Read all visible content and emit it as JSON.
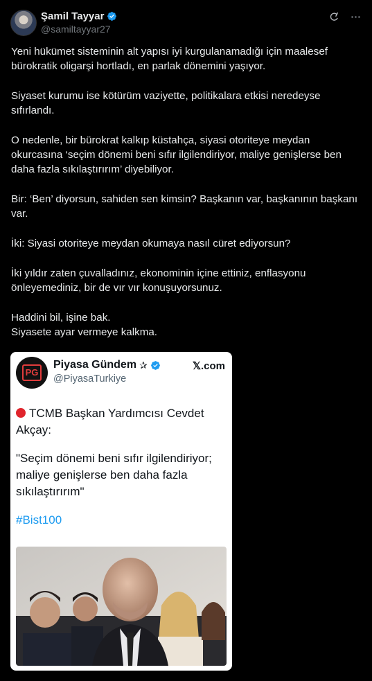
{
  "author": {
    "name": "Şamil Tayyar",
    "handle": "@samiltayyar27",
    "verified": true
  },
  "header_icons": [
    "grok-icon",
    "more-options-icon"
  ],
  "tweet": {
    "paragraphs": [
      "Yeni hükümet sisteminin alt yapısı iyi kurgulanamadığı için maalesef bürokratik oligarşi hortladı, en parlak dönemini yaşıyor.",
      "Siyaset kurumu ise kötürüm vaziyette, politikalara etkisi neredeyse sıfırlandı.",
      "O nedenle, bir bürokrat kalkıp küstahça, siyasi otoriteye meydan okurcasına ‘seçim dönemi beni sıfır ilgilendiriyor, maliye genişlerse ben daha fazla sıkılaştırırım’ diyebiliyor.",
      "Bir: ‘Ben’ diyorsun, sahiden sen kimsin? Başkanın var, başkanının başkanı var.",
      "İki: Siyasi otoriteye meydan okumaya nasıl cüret ediyorsun?",
      "İki yıldır zaten çuvalladınız, ekonominin içine ettiniz, enflasyonu önleyemediniz, bir de vır vır konuşuyorsunuz.",
      "Haddini bil, işine bak.\nSiyasete ayar vermeye kalkma."
    ]
  },
  "embedded_card": {
    "logo_text": "PG",
    "name": "Piyasa Gündem",
    "star": "✰",
    "handle": "@PiyasaTurkiye",
    "source": "𝕏.com",
    "headline": "TCMB Başkan Yardımcısı Cevdet Akçay:",
    "quote": "\"Seçim dönemi beni sıfır ilgilendiriyor; maliye genişlerse ben daha fazla sıkılaştırırım\"",
    "hashtag": "#Bist100"
  },
  "colors": {
    "background": "#000000",
    "text": "#e7e9ea",
    "muted": "#71767b",
    "verified_blue": "#1d9bf0",
    "hashtag": "#1d9bf0",
    "red_dot": "#e0242c"
  }
}
